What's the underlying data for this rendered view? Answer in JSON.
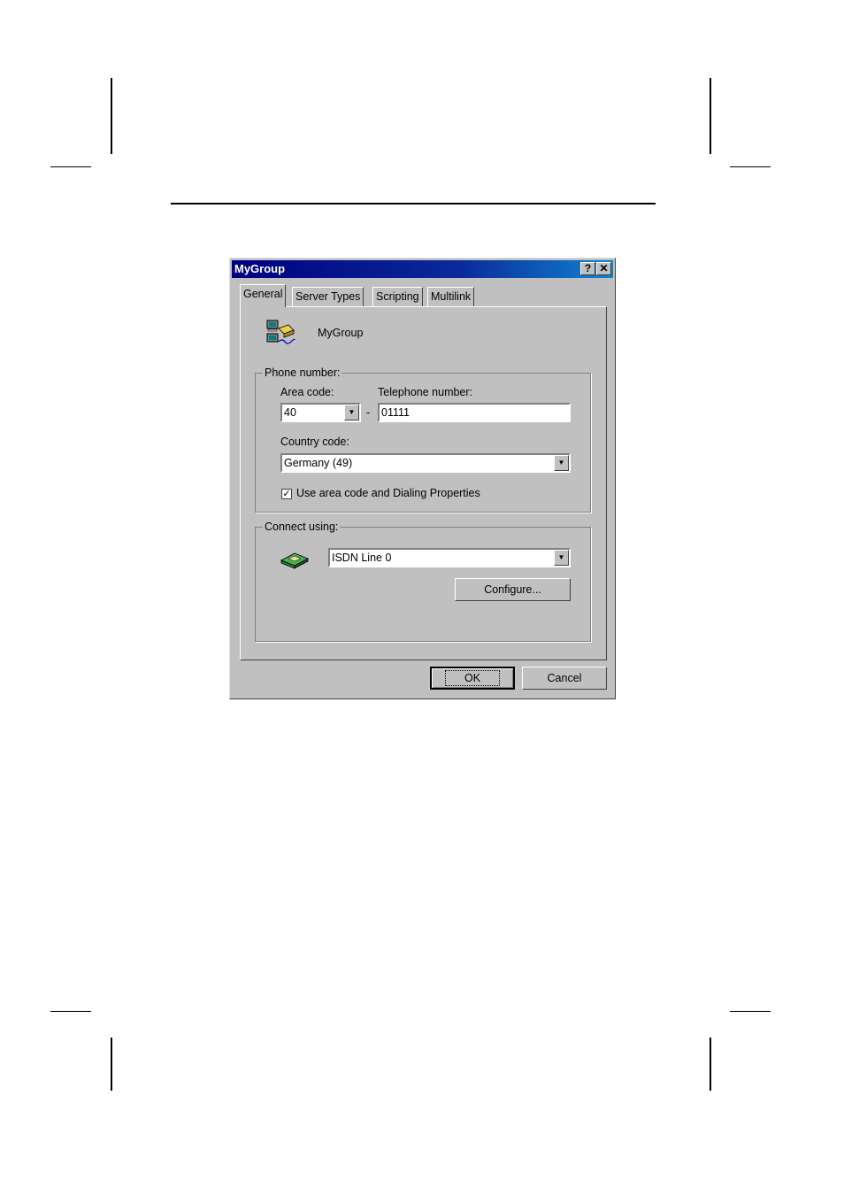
{
  "window": {
    "title": "MyGroup",
    "help_label": "?",
    "close_label": "✕"
  },
  "tabs": [
    {
      "label": "General",
      "active": true
    },
    {
      "label": "Server Types",
      "active": false
    },
    {
      "label": "Scripting",
      "active": false
    },
    {
      "label": "Multilink",
      "active": false
    }
  ],
  "general": {
    "connection_name": "MyGroup",
    "phone_group": {
      "legend": "Phone number:",
      "area_code_label": "Area code:",
      "area_code_value": "40",
      "separator": "-",
      "telephone_label": "Telephone number:",
      "telephone_value": "01111",
      "country_label": "Country code:",
      "country_value": "Germany (49)",
      "use_area_code_label": "Use area code and Dialing Properties",
      "use_area_code_checked": true
    },
    "connect_group": {
      "legend": "Connect using:",
      "device_value": "ISDN Line 0",
      "configure_label": "Configure..."
    }
  },
  "footer": {
    "ok_label": "OK",
    "cancel_label": "Cancel"
  },
  "icons": {
    "connection": "dialup-network-icon",
    "modem": "modem-icon",
    "dropdown": "dropdown-arrow-icon"
  },
  "colors": {
    "face": "#c0c0c0",
    "title_start": "#000080",
    "title_end": "#1084d0"
  }
}
